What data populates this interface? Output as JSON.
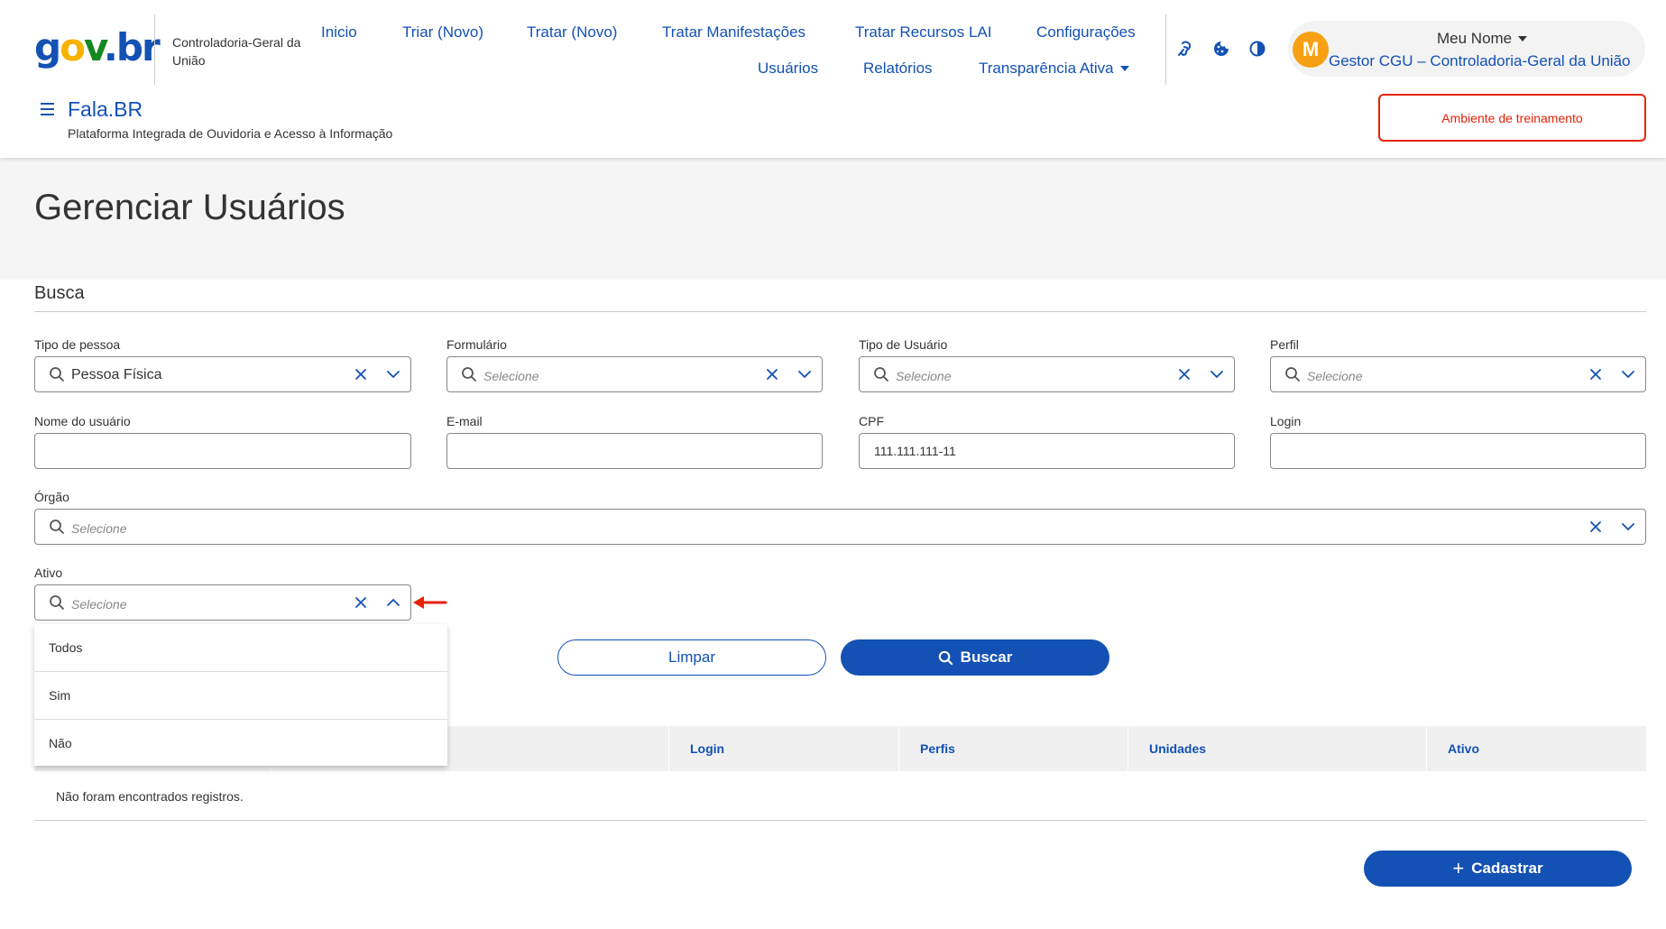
{
  "header": {
    "logo": {
      "g": "g",
      "o": "o",
      "v": "v",
      "dot": ".",
      "b": "b",
      "r": "r"
    },
    "org_name": "Controladoria-Geral da União",
    "nav": {
      "inicio": "Inicio",
      "triar": "Triar (Novo)",
      "tratar": "Tratar (Novo)",
      "tratar_manifestacoes": "Tratar Manifestações",
      "tratar_recursos": "Tratar Recursos LAI",
      "configuracoes": "Configurações",
      "usuarios": "Usuários",
      "relatorios": "Relatórios",
      "transparencia": "Transparência Ativa"
    },
    "icons": [
      "accessibility-icon",
      "cookie-icon",
      "contrast-icon"
    ],
    "user": {
      "avatar_initial": "M",
      "name": "Meu Nome",
      "role": "Gestor CGU – Controladoria-Geral da União"
    },
    "app_title": "Fala.BR",
    "app_subtitle": "Plataforma Integrada de Ouvidoria e Acesso à Informação",
    "env_button": "Ambiente de treinamento"
  },
  "page": {
    "title": "Gerenciar Usuários"
  },
  "search": {
    "section_title": "Busca",
    "tipo_pessoa": {
      "label": "Tipo de pessoa",
      "value": "Pessoa Física"
    },
    "formulario": {
      "label": "Formulário",
      "placeholder": "Selecione"
    },
    "tipo_usuario": {
      "label": "Tipo de Usuário",
      "placeholder": "Selecione"
    },
    "perfil": {
      "label": "Perfil",
      "placeholder": "Selecione"
    },
    "nome": {
      "label": "Nome do usuário",
      "value": ""
    },
    "email": {
      "label": "E-mail",
      "value": ""
    },
    "cpf": {
      "label": "CPF",
      "value": "111.111.111-11"
    },
    "login": {
      "label": "Login",
      "value": ""
    },
    "orgao": {
      "label": "Órgão",
      "placeholder": "Selecione"
    },
    "ativo": {
      "label": "Ativo",
      "placeholder": "Selecione",
      "options": [
        "Todos",
        "Sim",
        "Não"
      ]
    },
    "clear_button": "Limpar",
    "search_button": "Buscar"
  },
  "table": {
    "columns": [
      "Login",
      "Perfis",
      "Unidades",
      "Ativo"
    ],
    "empty_message": "Não foram encontrados registros."
  },
  "actions": {
    "add_button": "Cadastrar"
  },
  "colors": {
    "primary": "#1351b4",
    "accent_warning": "#e52207",
    "avatar": "#f8a013"
  }
}
